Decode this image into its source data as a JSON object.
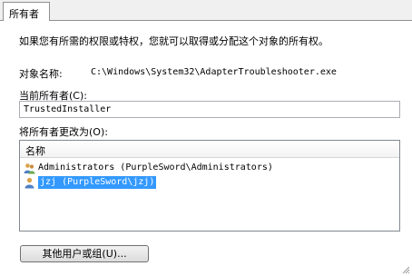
{
  "tab": {
    "label": "所有者"
  },
  "intro_text": "如果您有所需的权限或特权，您就可以取得或分配这个对象的所有权。",
  "object_name": {
    "label": "对象名称:",
    "value": "C:\\Windows\\System32\\AdapterTroubleshooter.exe"
  },
  "current_owner": {
    "label": "当前所有者(C):",
    "value": "TrustedInstaller"
  },
  "change_owner": {
    "label": "将所有者更改为(O):",
    "column_header": "名称",
    "items": [
      {
        "label": "Administrators (PurpleSword\\Administrators)",
        "icon": "user-group-icon",
        "selected": false
      },
      {
        "label": "jzj (PurpleSword\\jzj)",
        "icon": "user-icon",
        "selected": true
      }
    ]
  },
  "other_users_button": {
    "label": "其他用户或组(U)..."
  },
  "colors": {
    "selection": "#3399ff",
    "border": "#8e8f8f"
  }
}
